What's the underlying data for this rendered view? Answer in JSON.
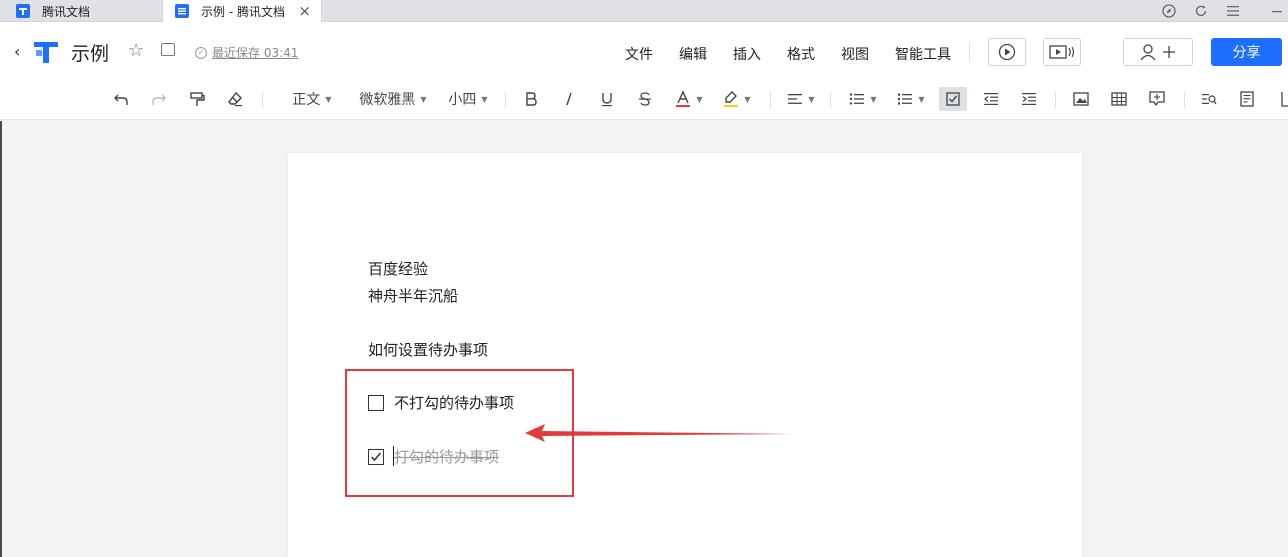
{
  "tabs": [
    {
      "label": "腾讯文档",
      "active": false
    },
    {
      "label": "示例 - 腾讯文档",
      "active": true
    }
  ],
  "header": {
    "title": "示例",
    "saved_status": "最近保存 03:41",
    "menus": [
      "文件",
      "编辑",
      "插入",
      "格式",
      "视图",
      "智能工具"
    ],
    "share_label": "分享"
  },
  "toolbar": {
    "style": "正文",
    "font": "微软雅黑",
    "size": "小四"
  },
  "document": {
    "lines": [
      "百度经验",
      "神舟半年沉船",
      "如何设置待办事项"
    ],
    "todos": [
      {
        "label": "不打勾的待办事项",
        "checked": false
      },
      {
        "label": "打勾的待办事项",
        "checked": true
      }
    ]
  },
  "colors": {
    "brand": "#1e6fff",
    "annotation": "#e33b3b",
    "font_color_indicator": "#e33b3b",
    "highlight_indicator": "#f5d400"
  }
}
